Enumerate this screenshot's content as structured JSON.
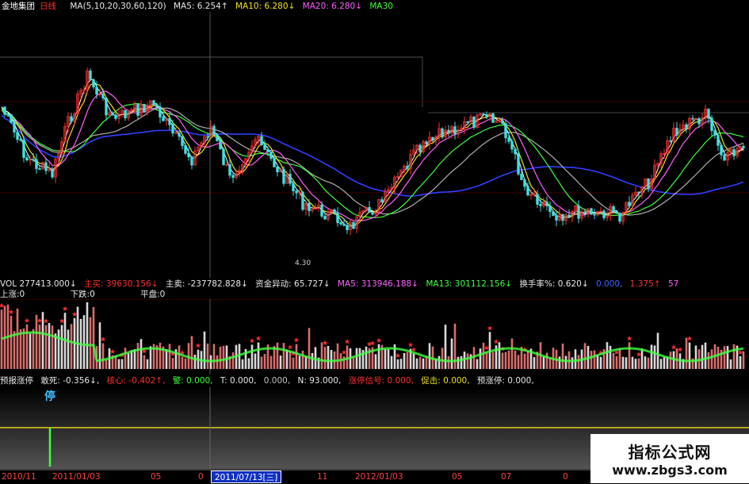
{
  "main_panel": {
    "stock_name": "金地集团",
    "period": "日线",
    "ma_params": "MA(5,10,20,30,60,120)",
    "ma5": "MA5: 6.254↑",
    "ma10": "MA10: 6.280↓",
    "ma20": "MA20: 6.280↓",
    "ma30": "MA30",
    "axis_tag": "4.30"
  },
  "volume_panel": {
    "vol": "VOL 277413.000↓",
    "main_buy": "主买: 39630.156↓",
    "main_sell": "主卖: -237782.828↓",
    "fund_move": "资金异动: 65.727↓",
    "ma5": "MA5: 313946.188↓",
    "ma13": "MA13: 301112.156↓",
    "turnover": "换手率%: 0.620↓",
    "extra1": "0.000,",
    "extra2": "1.375↑",
    "extra3": "57",
    "up_count": "上涨:0",
    "down_count": "下跌:0",
    "flat_count": "平盘:0"
  },
  "indicator_panel": {
    "name": "预报涨停",
    "f1": "敢死: -0.356↓,",
    "f2": "核心: -0.402↑,",
    "f3": "警: 0.000,",
    "f4": "T: 0.000,",
    "f5": "0.000,",
    "f6": "N: 93.000,",
    "f7": "涨停信号: 0.000,",
    "f8": "促击: 0.000,",
    "f9": "预涨停: 0.000,",
    "stop_mark": "停"
  },
  "time_axis": {
    "labels": [
      "2010/11",
      "2011/01/03",
      "05",
      "0",
      "11",
      "2012/01/03",
      "05",
      "07",
      "0"
    ],
    "selected": "2011/07/13[三]"
  },
  "watermark": {
    "line1": "指标公式网",
    "line2": "www.zbgs3.com"
  },
  "colors": {
    "up": "#ff3030",
    "down": "#40e0e0",
    "ma5": "#ffffff",
    "ma10": "#f0e020",
    "ma20": "#ff60ff",
    "ma30": "#40ff40",
    "ma60": "#3040ff",
    "ma120": "#b0b0b0",
    "yellow_line": "#e0d020"
  }
}
